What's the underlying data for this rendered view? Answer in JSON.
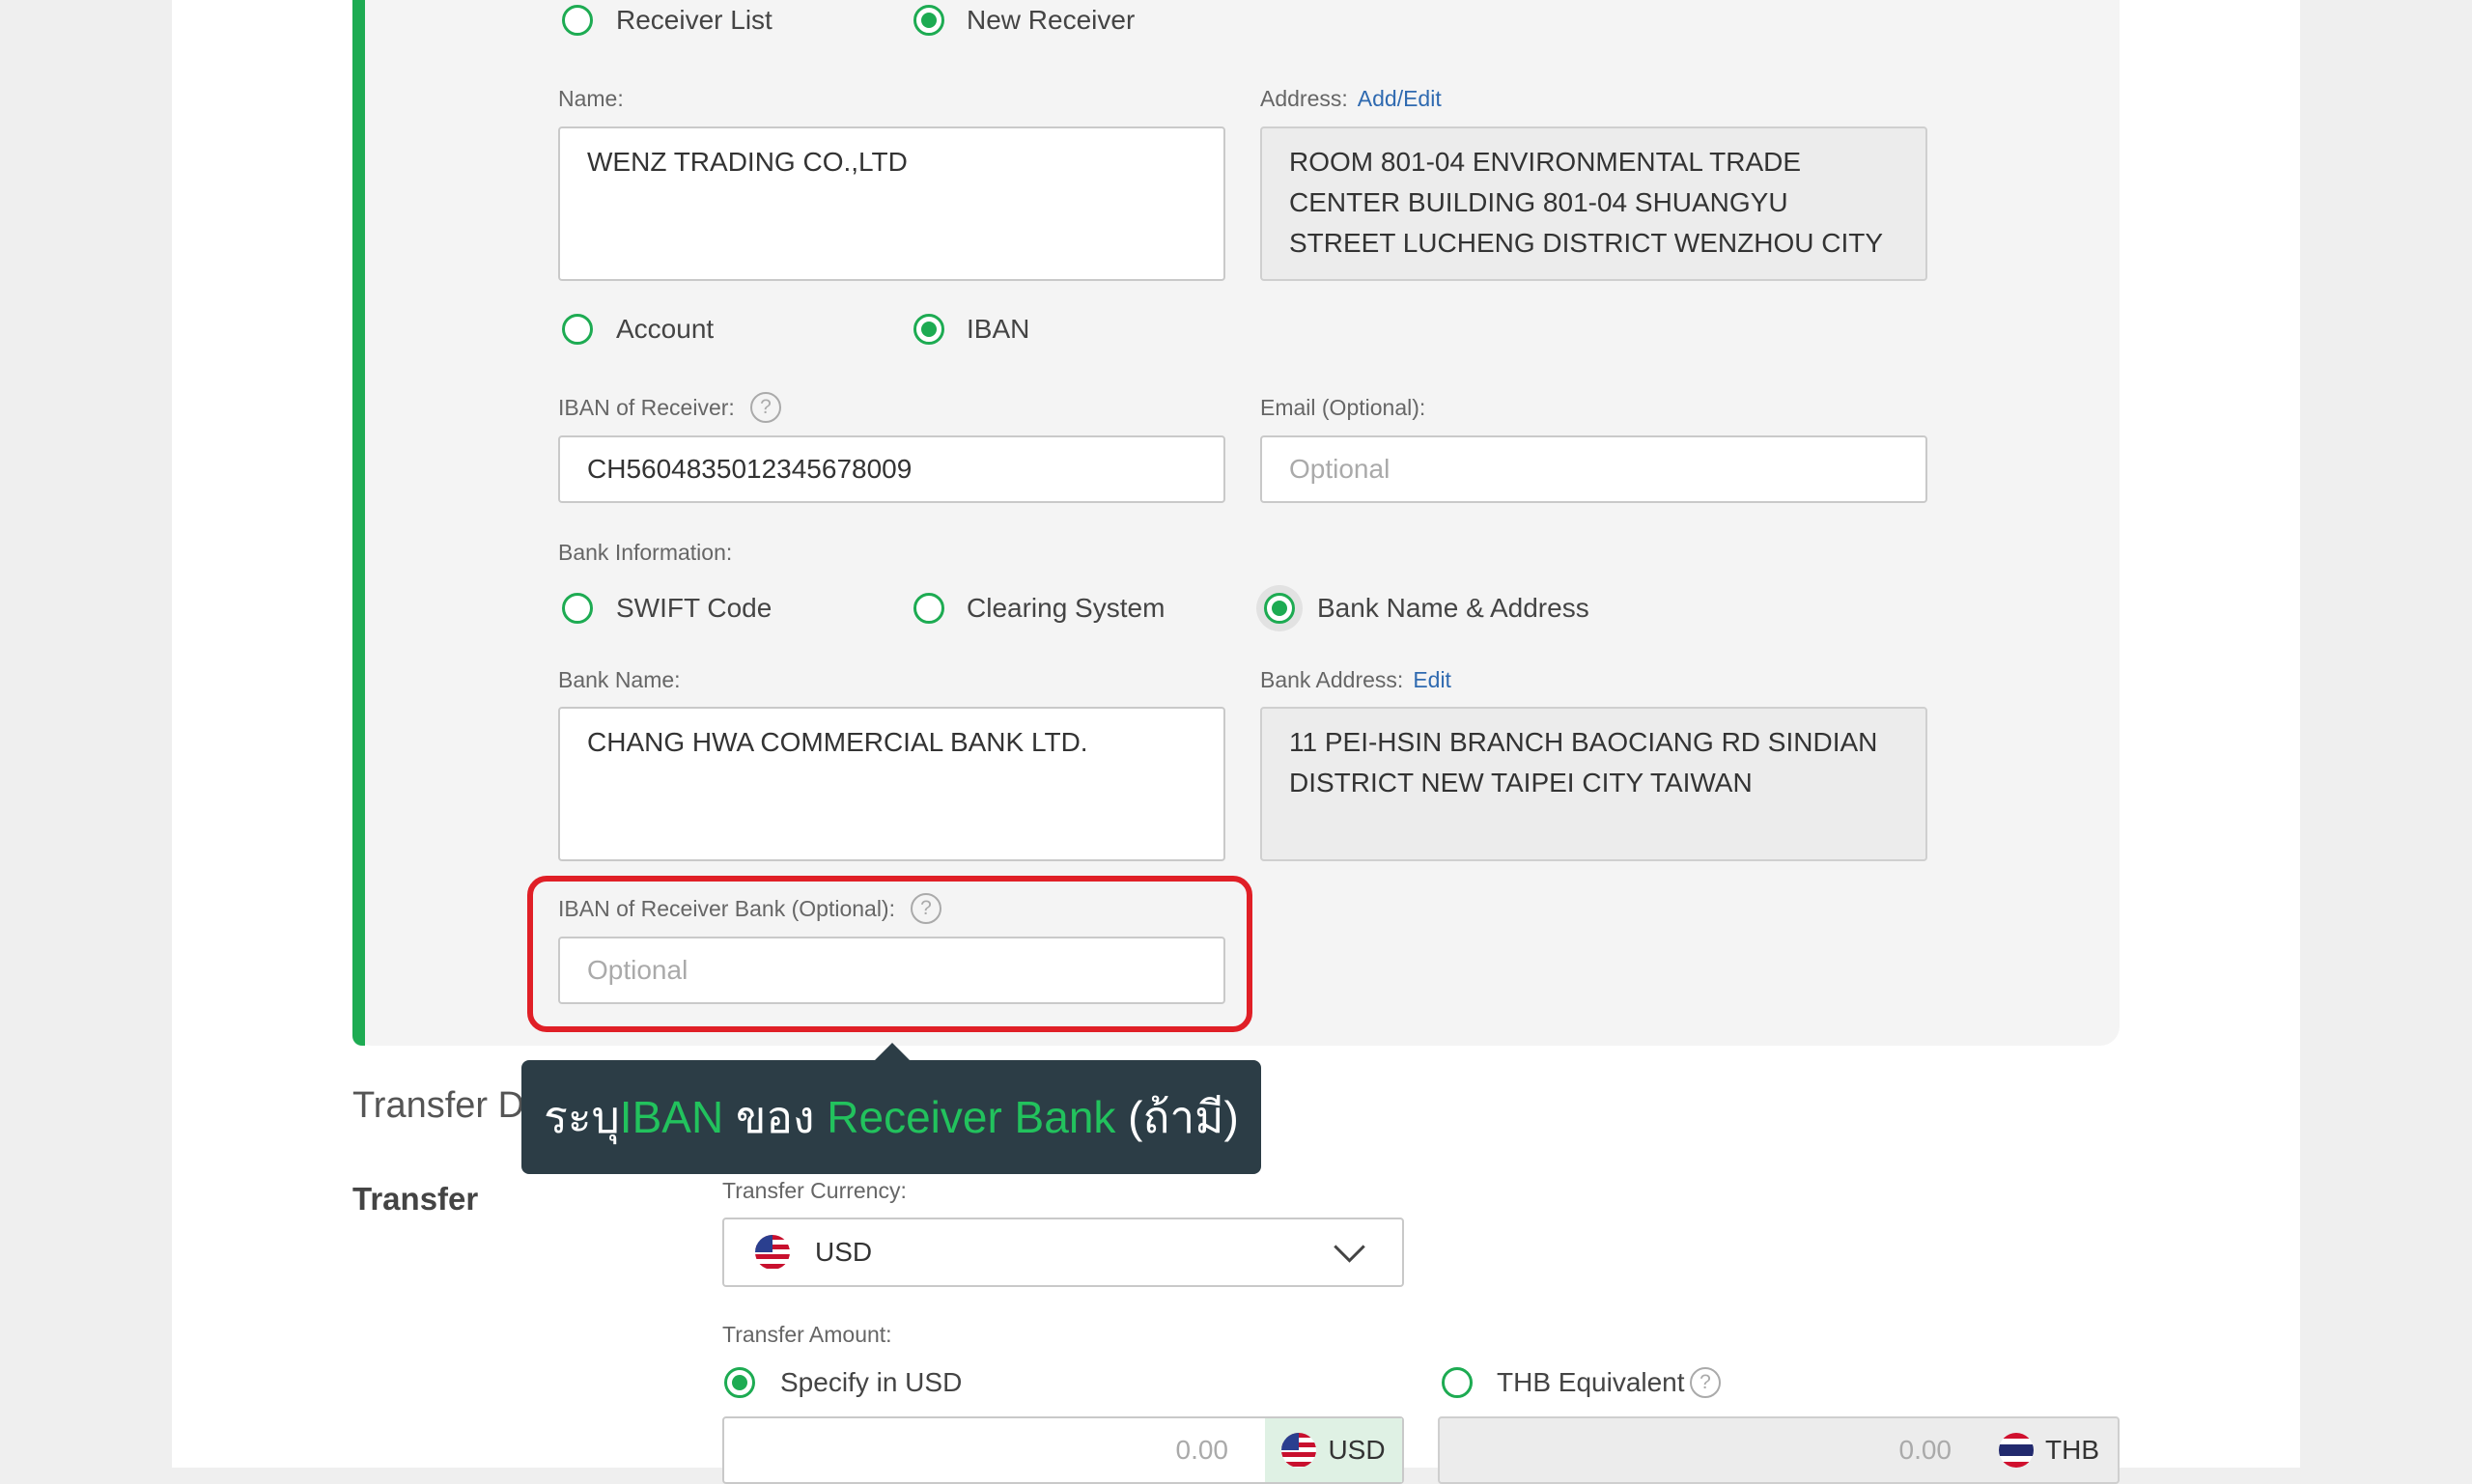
{
  "receiver_type": {
    "list_label": "Receiver List",
    "new_label": "New Receiver",
    "selected": "new"
  },
  "name": {
    "label": "Name:",
    "value": "WENZ TRADING CO.,LTD"
  },
  "address": {
    "label": "Address:",
    "link": "Add/Edit",
    "lines": [
      "ROOM 801-04 ENVIRONMENTAL TRADE",
      "CENTER BUILDING 801-04 SHUANGYU",
      "STREET LUCHENG DISTRICT WENZHOU CITY"
    ]
  },
  "account_type": {
    "account_label": "Account",
    "iban_label": "IBAN",
    "selected": "iban"
  },
  "iban_receiver": {
    "label": "IBAN of Receiver:",
    "value": "CH5604835012345678009"
  },
  "email": {
    "label": "Email (Optional):",
    "placeholder": "Optional"
  },
  "bank_info": {
    "label": "Bank Information:",
    "swift_label": "SWIFT Code",
    "clearing_label": "Clearing System",
    "name_address_label": "Bank Name & Address",
    "selected": "name_address"
  },
  "bank_name": {
    "label": "Bank Name:",
    "value": "CHANG HWA COMMERCIAL BANK LTD."
  },
  "bank_address": {
    "label": "Bank Address:",
    "link": "Edit",
    "lines": [
      "11 PEI-HSIN BRANCH BAOCIANG RD SINDIAN",
      "DISTRICT NEW TAIPEI CITY TAIWAN"
    ]
  },
  "iban_receiver_bank": {
    "label": "IBAN of Receiver Bank (Optional):",
    "placeholder": "Optional"
  },
  "help_glyph": "?",
  "tooltip": {
    "part1": "ระบุ ",
    "highlight1": "IBAN",
    "part2": " ของ ",
    "highlight2": "Receiver Bank",
    "part3": " (ถ้ามี)"
  },
  "transfer_details": {
    "heading_visible": "Transfer D",
    "sub_heading": "Transfer",
    "currency_label": "Transfer Currency:",
    "currency_value": "USD",
    "amount_label": "Transfer Amount:",
    "specify_label": "Specify in USD",
    "thb_equiv_label": "THB Equivalent",
    "amount_usd_value": "0.00",
    "amount_usd_currency": "USD",
    "amount_thb_value": "0.00",
    "amount_thb_currency": "THB"
  },
  "colors": {
    "accent_green": "#1dab52",
    "highlight_red": "#e01f26",
    "tooltip_bg": "#2c3d46",
    "link_blue": "#2f6ab0"
  },
  "icons": [
    "help-icon",
    "us-flag-icon",
    "th-flag-icon",
    "chevron-down-icon"
  ]
}
